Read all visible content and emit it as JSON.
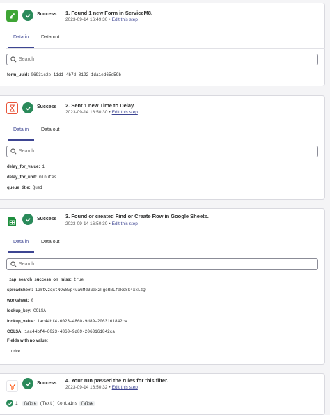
{
  "steps": [
    {
      "status": "Success",
      "title": "1. Found 1 new Form in ServiceM8.",
      "timestamp": "2023-09-14 16:49:30",
      "edit_link": "Edit this step",
      "app_icon": "servicem8-icon",
      "tabs": {
        "data_in": "Data in",
        "data_out": "Data out"
      },
      "search_placeholder": "Search",
      "fields": [
        {
          "key": "form_uuid:",
          "value": "06931c2e-11d1-4b7d-8192-1da1ed65e59b"
        }
      ]
    },
    {
      "status": "Success",
      "title": "2. Sent 1 new Time to Delay.",
      "timestamp": "2023-09-14 16:50:30",
      "edit_link": "Edit this step",
      "app_icon": "delay-hourglass-icon",
      "tabs": {
        "data_in": "Data in",
        "data_out": "Data out"
      },
      "search_placeholder": "Search",
      "fields": [
        {
          "key": "delay_for_value:",
          "value": "1"
        },
        {
          "key": "delay_for_unit:",
          "value": "minutes"
        },
        {
          "key": "queue_title:",
          "value": "Que1"
        }
      ]
    },
    {
      "status": "Success",
      "title": "3. Found or created Find or Create Row in Google Sheets.",
      "timestamp": "2023-09-14 16:50:30",
      "edit_link": "Edit this step",
      "app_icon": "google-sheets-icon",
      "tabs": {
        "data_in": "Data in",
        "data_out": "Data out"
      },
      "search_placeholder": "Search",
      "fields": [
        {
          "key": "_zap_search_success_on_miss:",
          "value": "true"
        },
        {
          "key": "spreadsheet:",
          "value": "1GmtvzqctNOW8vp4uaGMd3Gex2FgcRNLf0ks8k4xxLzQ"
        },
        {
          "key": "worksheet:",
          "value": "0"
        },
        {
          "key": "lookup_key:",
          "value": "COL$A"
        },
        {
          "key": "lookup_value:",
          "value": "1ac44bf4-6023-4860-9d89-2063161842ca"
        },
        {
          "key": "COL$A:",
          "value": "1ac44bf4-6023-4860-9d89-2063161842ca"
        },
        {
          "key": "Fields with no value:",
          "value": ""
        }
      ],
      "no_value_items": [
        "drive"
      ]
    },
    {
      "status": "Success",
      "title": "4. Your run passed the rules for this filter.",
      "timestamp": "2023-09-14 16:50:32",
      "edit_link": "Edit this step",
      "app_icon": "filter-icon"
    }
  ],
  "filter_rule": {
    "index": "1.",
    "left": "false",
    "op": "(Text) Contains",
    "right": "false"
  },
  "colors": {
    "accent": "#3d4592",
    "success": "#2a8a5a",
    "servicem8": "#3fa535",
    "sheets": "#1e8e3e",
    "delay": "#e8553a",
    "filter": "#ff4a00"
  }
}
